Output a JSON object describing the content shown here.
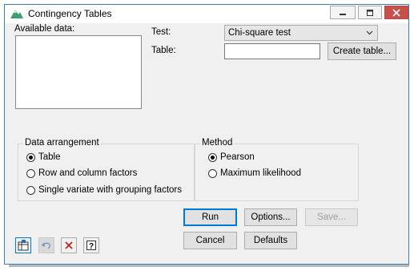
{
  "window": {
    "title": "Contingency Tables"
  },
  "available_data": {
    "label": "Available data:"
  },
  "test": {
    "label": "Test:",
    "selected": "Chi-square test"
  },
  "table": {
    "label": "Table:",
    "value": "",
    "create_button": "Create table..."
  },
  "data_arrangement": {
    "title": "Data arrangement",
    "options": [
      "Table",
      "Row and column factors",
      "Single variate with grouping factors"
    ],
    "selected": "Table"
  },
  "method": {
    "title": "Method",
    "options": [
      "Pearson",
      "Maximum likelihood"
    ],
    "selected": "Pearson"
  },
  "buttons": {
    "run": "Run",
    "options": "Options...",
    "save": "Save...",
    "cancel": "Cancel",
    "defaults": "Defaults"
  },
  "colors": {
    "accent": "#0078d7",
    "close": "#c7504a",
    "window_bg": "#f0f0f0"
  }
}
